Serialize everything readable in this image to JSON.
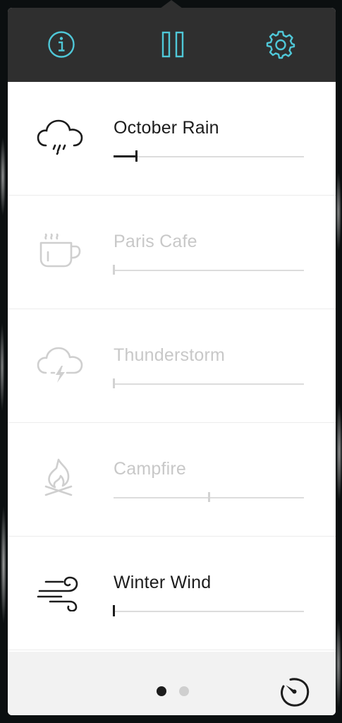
{
  "toolbar": {
    "accent_color": "#4fc8d8",
    "background": "#2f2f2f",
    "buttons": [
      {
        "name": "info",
        "icon": "info-icon"
      },
      {
        "name": "pause",
        "icon": "pause-icon"
      },
      {
        "name": "settings",
        "icon": "gear-icon"
      }
    ]
  },
  "sounds": [
    {
      "label": "October Rain",
      "icon": "rain-cloud-icon",
      "active": true,
      "volume": 0.12
    },
    {
      "label": "Paris Cafe",
      "icon": "coffee-cup-icon",
      "active": false,
      "volume": 0.0
    },
    {
      "label": "Thunderstorm",
      "icon": "thunder-cloud-icon",
      "active": false,
      "volume": 0.0
    },
    {
      "label": "Campfire",
      "icon": "campfire-icon",
      "active": false,
      "volume": 0.5
    },
    {
      "label": "Winter Wind",
      "icon": "wind-icon",
      "active": true,
      "volume": 0.0
    }
  ],
  "footer": {
    "pages": 2,
    "current_page": 1,
    "timer_icon": "timer-icon"
  }
}
